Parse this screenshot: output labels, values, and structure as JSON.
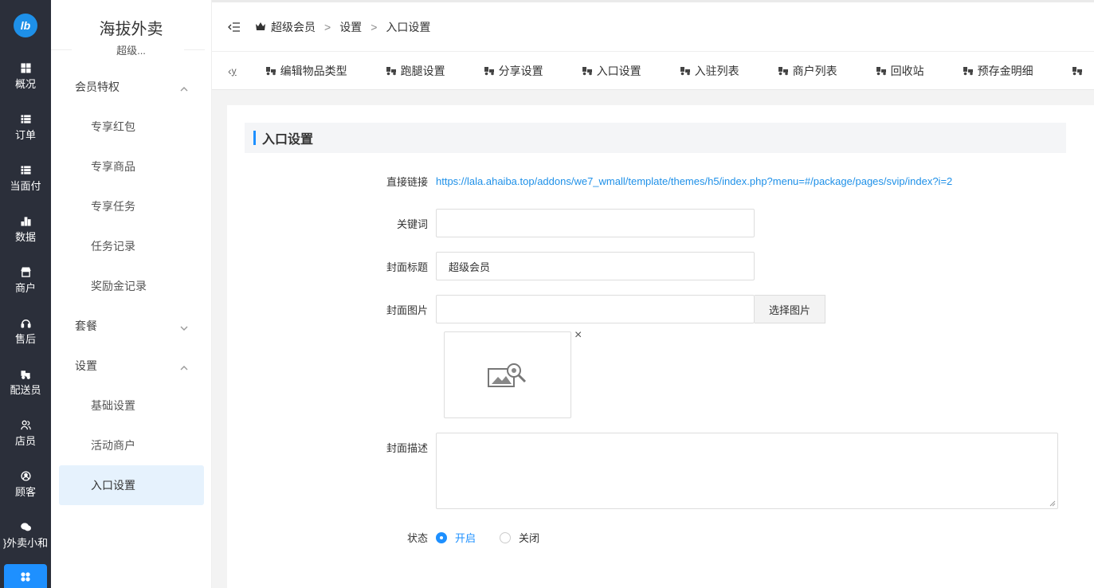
{
  "rail": {
    "logo_text": "lb",
    "items": [
      {
        "label": "概况",
        "icon": "dashboard-icon"
      },
      {
        "label": "订单",
        "icon": "list-icon"
      },
      {
        "label": "当面付",
        "icon": "list-icon"
      },
      {
        "label": "数据",
        "icon": "bar-chart-icon"
      },
      {
        "label": "商户",
        "icon": "store-icon"
      },
      {
        "label": "售后",
        "icon": "headset-icon"
      },
      {
        "label": "配送员",
        "icon": "delivery-icon"
      },
      {
        "label": "店员",
        "icon": "users-icon"
      },
      {
        "label": "顾客",
        "icon": "user-circle-icon"
      },
      {
        "label": "}外卖小和",
        "icon": "wechat-icon"
      }
    ],
    "active_icon": "apps-icon"
  },
  "sidebar": {
    "brand": "海拔外卖",
    "sub": "超级...",
    "groups": [
      {
        "label": "会员特权",
        "expanded": true,
        "items": [
          "专享红包",
          "专享商品",
          "专享任务",
          "任务记录",
          "奖励金记录"
        ]
      },
      {
        "label": "套餐",
        "expanded": false,
        "items": []
      },
      {
        "label": "设置",
        "expanded": true,
        "items": [
          "基础设置",
          "活动商户",
          "入口设置"
        ]
      }
    ],
    "active_item": "入口设置"
  },
  "topbar": {
    "breadcrumb": [
      "超级会员",
      "设置",
      "入口设置"
    ],
    "separator": ">"
  },
  "tabs": {
    "prev_label": "y",
    "items": [
      "编辑物品类型",
      "跑腿设置",
      "分享设置",
      "入口设置",
      "入驻列表",
      "商户列表",
      "回收站",
      "预存金明细"
    ]
  },
  "form": {
    "section_title": "入口设置",
    "direct_link_label": "直接链接",
    "direct_link": "https://lala.ahaiba.top/addons/we7_wmall/template/themes/h5/index.php?menu=#/package/pages/svip/index?i=2",
    "keyword_label": "关键词",
    "keyword_value": "",
    "cover_title_label": "封面标题",
    "cover_title_value": "超级会员",
    "cover_image_label": "封面图片",
    "cover_image_value": "",
    "select_image_button": "选择图片",
    "remove_symbol": "×",
    "cover_desc_label": "封面描述",
    "cover_desc_value": "",
    "status_label": "状态",
    "status_options": [
      "开启",
      "关闭"
    ],
    "status_selected": "开启"
  },
  "colors": {
    "accent": "#1e90ff",
    "rail_bg": "#2b2f3a",
    "active_item_bg": "#e6f2fd"
  }
}
